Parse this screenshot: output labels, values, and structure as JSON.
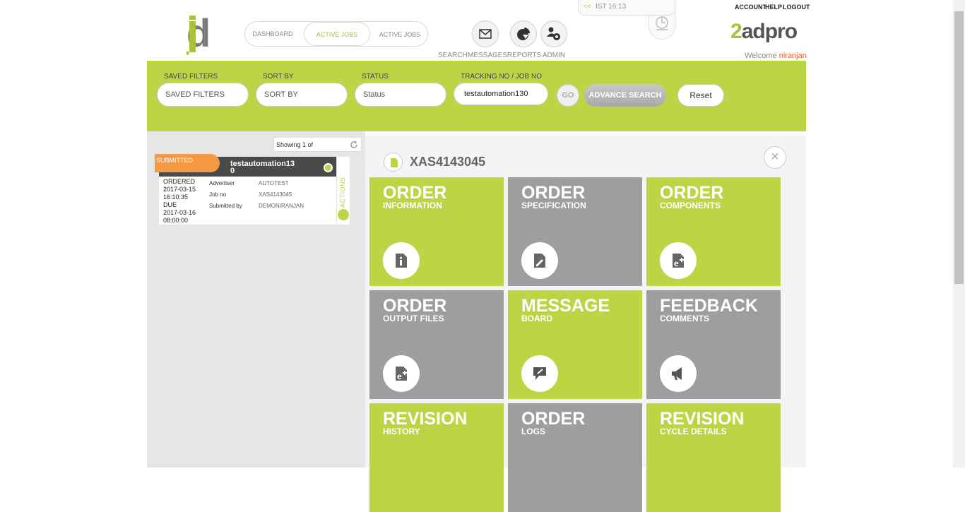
{
  "header": {
    "logo_text": "jd",
    "nav_tabs": [
      {
        "label": "DASHBOARD"
      },
      {
        "label": "ACTIVE JOBS"
      },
      {
        "label": "ACTIVE JOBS"
      }
    ],
    "icons": [
      {
        "label": "SEARCH",
        "icon": "search-icon"
      },
      {
        "label": "MESSAGES",
        "icon": "mail-icon"
      },
      {
        "label": "REPORTS",
        "icon": "pie-chart-icon"
      },
      {
        "label": "ADMIN",
        "icon": "users-gear-icon"
      }
    ],
    "clock": {
      "arrows": "<<",
      "time": "IST 16:13"
    },
    "links": {
      "account": "ACCOUNT",
      "help": "HELP",
      "logout": "LOGOUT"
    },
    "brand": {
      "part1": "2",
      "part2": "adpro"
    },
    "welcome": {
      "prefix": "Welcome",
      "user": "niranjan"
    }
  },
  "filters": {
    "saved_filters": {
      "label": "SAVED FILTERS",
      "value": "SAVED FILTERS"
    },
    "sort_by": {
      "label": "SORT BY",
      "value": "SORT BY"
    },
    "status": {
      "label": "STATUS",
      "value": "Status"
    },
    "tracking": {
      "label": "TRACKING NO / JOB NO",
      "value": "testautomation130"
    },
    "go_label": "GO",
    "advance_search_label": "ADVANCE SEARCH",
    "reset_label": "Reset"
  },
  "job_list": {
    "showing_text": "Showing 1 of",
    "card": {
      "status": "SUBMITTED",
      "title": "testautomation13\n0",
      "ordered_label": "ORDERED",
      "ordered_date": "2017-03-15",
      "ordered_time": "16:10:35",
      "due_label": "DUE",
      "due_date": "2017-03-16",
      "due_time": "08:00:00",
      "advertiser_key": "Advertiser",
      "advertiser_val": "AUTOTEST",
      "jobno_key": "Job no",
      "jobno_val": "XAS4143045",
      "submitted_key": "Submitted by",
      "submitted_val": "DEMONIRANJAN",
      "actions_label": "ACTIONS"
    }
  },
  "detail": {
    "order_id": "XAS4143045",
    "close": "×",
    "tiles": [
      {
        "title": "ORDER",
        "sub": "INFORMATION",
        "icon": "info-doc-icon"
      },
      {
        "title": "ORDER",
        "sub": "SPECIFICATION",
        "icon": "edit-doc-icon"
      },
      {
        "title": "ORDER",
        "sub": "COMPONENTS",
        "icon": "add-doc-icon"
      },
      {
        "title": "ORDER",
        "sub": "OUTPUT FILES",
        "icon": "output-doc-icon"
      },
      {
        "title": "MESSAGE",
        "sub": "BOARD",
        "icon": "message-board-icon"
      },
      {
        "title": "FEEDBACK",
        "sub": "COMMENTS",
        "icon": "megaphone-icon"
      },
      {
        "title": "REVISION",
        "sub": "HISTORY",
        "icon": "history-icon"
      },
      {
        "title": "ORDER",
        "sub": "LOGS",
        "icon": "log-icon"
      },
      {
        "title": "REVISION",
        "sub": "CYCLE DETAILS",
        "icon": "cycle-icon"
      }
    ]
  },
  "colors": {
    "accent_green": "#bcd545",
    "tile_gray": "#9e9e9f",
    "status_orange": "#f49a44",
    "user_red": "#e35b2e"
  }
}
